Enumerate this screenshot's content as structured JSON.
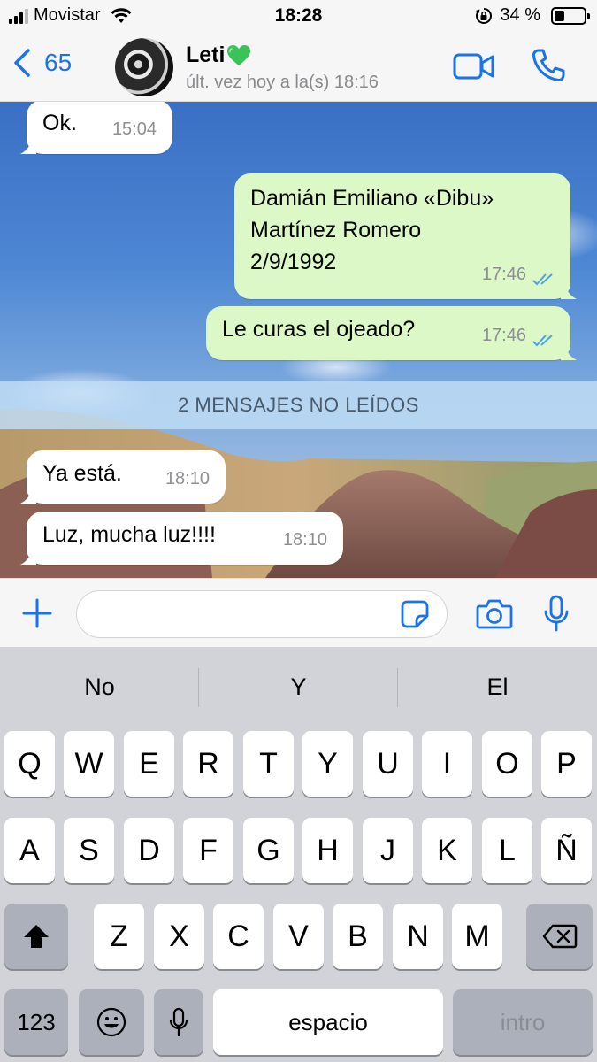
{
  "status_bar": {
    "carrier": "Movistar",
    "time": "18:28",
    "battery_text": "34 %",
    "battery_level": 0.34,
    "icons": [
      "signal-icon",
      "wifi-icon",
      "orientation-lock-icon",
      "battery-icon"
    ]
  },
  "header": {
    "back_count": "65",
    "contact_name": "Leti",
    "contact_status": "últ. vez hoy a la(s) 18:16",
    "icons": [
      "back-chevron-icon",
      "green-heart-icon",
      "video-call-icon",
      "phone-call-icon"
    ]
  },
  "messages": [
    {
      "direction": "in",
      "text": "Ok.",
      "time": "15:04"
    },
    {
      "direction": "out",
      "lines": [
        "Damián Emiliano «Dibu»",
        "Martínez Romero",
        "2/9/1992"
      ],
      "time": "17:46",
      "read": true
    },
    {
      "direction": "out",
      "text": "Le curas el ojeado?",
      "time": "17:46",
      "read": true
    },
    {
      "direction": "in",
      "text": "Ya está.",
      "time": "18:10"
    },
    {
      "direction": "in",
      "text": "Luz, mucha luz!!!!",
      "time": "18:10"
    }
  ],
  "unread_banner": "2 MENSAJES NO LEÍDOS",
  "input_bar": {
    "placeholder": "",
    "icons": [
      "plus-icon",
      "sticker-icon",
      "camera-icon",
      "microphone-icon"
    ]
  },
  "keyboard": {
    "suggestions": [
      "No",
      "Y",
      "El"
    ],
    "row1": [
      "Q",
      "W",
      "E",
      "R",
      "T",
      "Y",
      "U",
      "I",
      "O",
      "P"
    ],
    "row2": [
      "A",
      "S",
      "D",
      "F",
      "G",
      "H",
      "J",
      "K",
      "L",
      "Ñ"
    ],
    "row3": [
      "Z",
      "X",
      "C",
      "V",
      "B",
      "N",
      "M"
    ],
    "numbers_label": "123",
    "space_label": "espacio",
    "return_label": "intro",
    "icons": [
      "shift-icon",
      "backspace-icon",
      "emoji-icon",
      "dictation-mic-icon"
    ]
  },
  "colors": {
    "accent": "#1a73e8",
    "outgoing_bubble": "#dcf8c6",
    "incoming_bubble": "#ffffff",
    "read_ticks": "#4fa3e0",
    "heart": "#3cc25a"
  }
}
